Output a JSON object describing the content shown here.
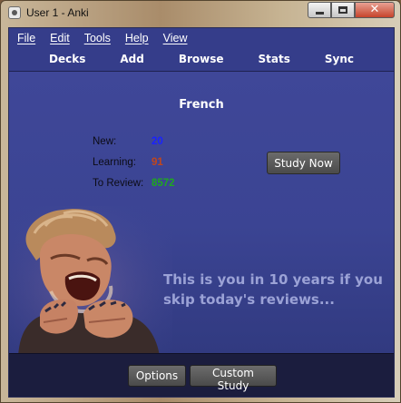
{
  "window": {
    "title": "User 1 - Anki",
    "close_glyph": "✕"
  },
  "menubar": {
    "items": [
      "File",
      "Edit",
      "Tools",
      "Help",
      "View"
    ]
  },
  "toplinks": [
    "Decks",
    "Add",
    "Browse",
    "Stats",
    "Sync"
  ],
  "deck": {
    "name": "French",
    "new_label": "New:",
    "new_count": "20",
    "learning_label": "Learning:",
    "learning_count": "91",
    "review_label": "To Review:",
    "review_count": "8572",
    "study_button": "Study Now",
    "motivation_text": "This is you in 10 years if you skip today's reviews..."
  },
  "bottom": {
    "options_label": "Options",
    "custom_study_label": "Custom Study"
  },
  "colors": {
    "new": "#1a23ff",
    "learning": "#c2461b",
    "review": "#1fa81f"
  }
}
